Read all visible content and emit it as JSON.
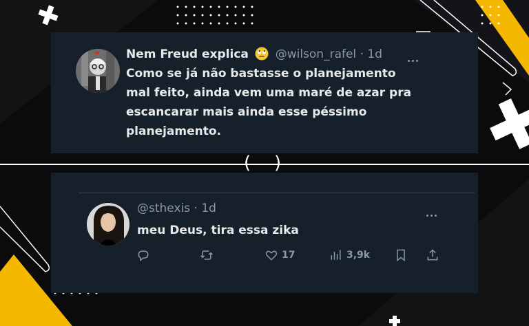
{
  "tweet1": {
    "display_name": "Nem Freud explica",
    "handle": "@wilson_rafel",
    "separator": "·",
    "time": "1d",
    "text": "Como se já não bastasse o planejamento\nmal feito, ainda vem uma maré de azar pra\nescancarar mais ainda esse péssimo\nplanejamento.",
    "emoji_icon": "eye-roll-emoji-icon"
  },
  "tweet2": {
    "handle": "@sthexis",
    "separator": "·",
    "time": "1d",
    "text": "meu Deus, tira essa zika",
    "actions": {
      "likes": "17",
      "views": "3,9k"
    }
  },
  "colors": {
    "card_bg": "#15202b",
    "accent_yellow": "#f5b800",
    "secondary_text": "#8b98a5"
  }
}
